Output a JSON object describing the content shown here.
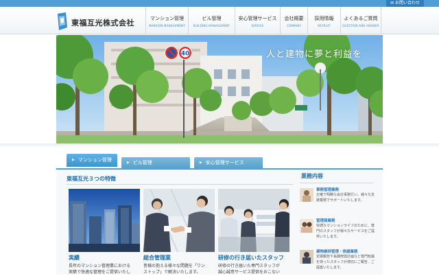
{
  "topbar": {
    "contact_label": "お問い合わせ"
  },
  "logo": {
    "text": "東福互光株式会社"
  },
  "nav": [
    {
      "jp": "マンション管理",
      "en": "MANSION MANAGEMENT"
    },
    {
      "jp": "ビル管理",
      "en": "BUILDING MANAGEMENT"
    },
    {
      "jp": "安心管理サービス",
      "en": "SERVICE"
    },
    {
      "jp": "会社概要",
      "en": "COMPANY"
    },
    {
      "jp": "採用情報",
      "en": "RECRUIT"
    },
    {
      "jp": "よくあるご質問",
      "en": "QUESTION AND ANSWER"
    }
  ],
  "hero": {
    "copy": "人と建物に夢と利益を",
    "sign_number": "40"
  },
  "tabs": [
    {
      "label": "マンション管理",
      "active": true
    },
    {
      "label": "ビル管理",
      "active": false
    },
    {
      "label": "安心管理サービス",
      "active": false
    }
  ],
  "features": {
    "title": "東福互光３つの特徴",
    "cards": [
      {
        "title": "実績",
        "lines": [
          "長年のマンション管理業における",
          "実績で快適な管理をご提供いたし"
        ]
      },
      {
        "title": "総合管理業",
        "lines": [
          "皆様の抱える様々な問題を「ワン",
          "ストップ」で解決いたします。"
        ]
      },
      {
        "title": "研修の行き届いたスタッフ",
        "lines": [
          "研修の行き届いた専門スタッフが",
          "誠心誠意サービス提供をおこない"
        ]
      }
    ]
  },
  "business": {
    "title": "業務内容",
    "items": [
      {
        "title": "事務管理業務",
        "desc": "正確で明瞭な会計事務行い、様々な支援業務でサポートいたします。"
      },
      {
        "title": "管理員業務",
        "desc": "快適なマンションライフのために、専門のスタッフが様々なサービスをご提供いたします。"
      },
      {
        "title": "建物維持管理・修繕業務",
        "desc": "定期報告や長期修繕計画など専門知識を持ったスタッフが適切にご報告、ご提案いたします。"
      }
    ]
  },
  "colors": {
    "accent": "#3b8fcf",
    "heading": "#1d6ea8",
    "tab_active": "#4aa2da"
  }
}
